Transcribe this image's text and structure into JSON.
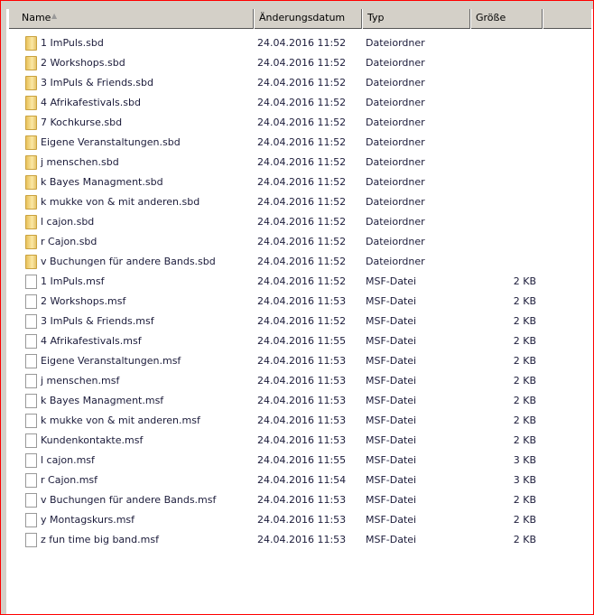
{
  "columns": {
    "name": "Name",
    "date": "Änderungsdatum",
    "type": "Typ",
    "size": "Größe"
  },
  "files": [
    {
      "name": "1 ImPuls.sbd",
      "date": "24.04.2016 11:52",
      "type": "Dateiordner",
      "size": "",
      "icon": "folder"
    },
    {
      "name": "2 Workshops.sbd",
      "date": "24.04.2016 11:52",
      "type": "Dateiordner",
      "size": "",
      "icon": "folder"
    },
    {
      "name": "3 ImPuls & Friends.sbd",
      "date": "24.04.2016 11:52",
      "type": "Dateiordner",
      "size": "",
      "icon": "folder"
    },
    {
      "name": "4 Afrikafestivals.sbd",
      "date": "24.04.2016 11:52",
      "type": "Dateiordner",
      "size": "",
      "icon": "folder"
    },
    {
      "name": "7 Kochkurse.sbd",
      "date": "24.04.2016 11:52",
      "type": "Dateiordner",
      "size": "",
      "icon": "folder"
    },
    {
      "name": "Eigene Veranstaltungen.sbd",
      "date": "24.04.2016 11:52",
      "type": "Dateiordner",
      "size": "",
      "icon": "folder"
    },
    {
      "name": "j menschen.sbd",
      "date": "24.04.2016 11:52",
      "type": "Dateiordner",
      "size": "",
      "icon": "folder"
    },
    {
      "name": "k Bayes Managment.sbd",
      "date": "24.04.2016 11:52",
      "type": "Dateiordner",
      "size": "",
      "icon": "folder"
    },
    {
      "name": "k mukke von & mit anderen.sbd",
      "date": "24.04.2016 11:52",
      "type": "Dateiordner",
      "size": "",
      "icon": "folder"
    },
    {
      "name": "l cajon.sbd",
      "date": "24.04.2016 11:52",
      "type": "Dateiordner",
      "size": "",
      "icon": "folder"
    },
    {
      "name": "r Cajon.sbd",
      "date": "24.04.2016 11:52",
      "type": "Dateiordner",
      "size": "",
      "icon": "folder"
    },
    {
      "name": "v Buchungen für andere Bands.sbd",
      "date": "24.04.2016 11:52",
      "type": "Dateiordner",
      "size": "",
      "icon": "folder"
    },
    {
      "name": "1 ImPuls.msf",
      "date": "24.04.2016 11:52",
      "type": "MSF-Datei",
      "size": "2 KB",
      "icon": "file"
    },
    {
      "name": "2 Workshops.msf",
      "date": "24.04.2016 11:53",
      "type": "MSF-Datei",
      "size": "2 KB",
      "icon": "file"
    },
    {
      "name": "3 ImPuls & Friends.msf",
      "date": "24.04.2016 11:52",
      "type": "MSF-Datei",
      "size": "2 KB",
      "icon": "file"
    },
    {
      "name": "4 Afrikafestivals.msf",
      "date": "24.04.2016 11:55",
      "type": "MSF-Datei",
      "size": "2 KB",
      "icon": "file"
    },
    {
      "name": "Eigene Veranstaltungen.msf",
      "date": "24.04.2016 11:53",
      "type": "MSF-Datei",
      "size": "2 KB",
      "icon": "file"
    },
    {
      "name": "j menschen.msf",
      "date": "24.04.2016 11:53",
      "type": "MSF-Datei",
      "size": "2 KB",
      "icon": "file"
    },
    {
      "name": "k Bayes Managment.msf",
      "date": "24.04.2016 11:53",
      "type": "MSF-Datei",
      "size": "2 KB",
      "icon": "file"
    },
    {
      "name": "k mukke von & mit anderen.msf",
      "date": "24.04.2016 11:53",
      "type": "MSF-Datei",
      "size": "2 KB",
      "icon": "file"
    },
    {
      "name": "Kundenkontakte.msf",
      "date": "24.04.2016 11:53",
      "type": "MSF-Datei",
      "size": "2 KB",
      "icon": "file"
    },
    {
      "name": "l cajon.msf",
      "date": "24.04.2016 11:55",
      "type": "MSF-Datei",
      "size": "3 KB",
      "icon": "file"
    },
    {
      "name": "r Cajon.msf",
      "date": "24.04.2016 11:54",
      "type": "MSF-Datei",
      "size": "3 KB",
      "icon": "file"
    },
    {
      "name": "v Buchungen für andere Bands.msf",
      "date": "24.04.2016 11:53",
      "type": "MSF-Datei",
      "size": "2 KB",
      "icon": "file"
    },
    {
      "name": "y Montagskurs.msf",
      "date": "24.04.2016 11:53",
      "type": "MSF-Datei",
      "size": "2 KB",
      "icon": "file"
    },
    {
      "name": "z fun time big band.msf",
      "date": "24.04.2016 11:53",
      "type": "MSF-Datei",
      "size": "2 KB",
      "icon": "file"
    }
  ]
}
